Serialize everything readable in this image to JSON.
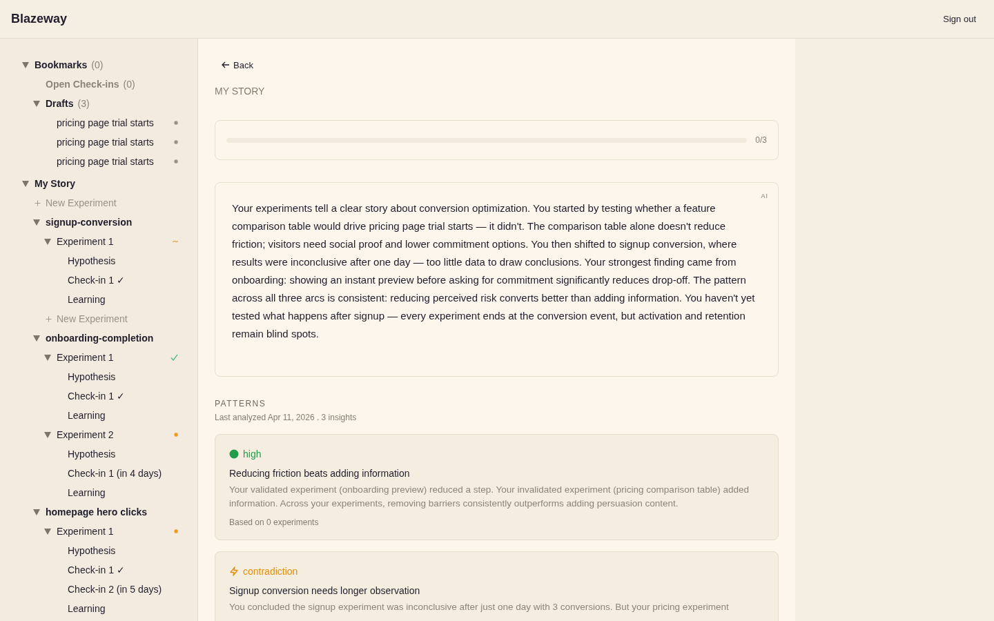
{
  "header": {
    "brand": "Blazeway",
    "sign_out": "Sign out"
  },
  "sidebar": {
    "tree": [
      {
        "label": "Bookmarks",
        "count": "(0)",
        "kind": "section",
        "expanded": true,
        "children": [
          {
            "label": "Open Check-ins",
            "count": "(0)",
            "kind": "empty"
          },
          {
            "label": "Drafts",
            "count": "(3)",
            "kind": "section",
            "expanded": true,
            "children": [
              {
                "label": "pricing page trial starts",
                "kind": "item",
                "marker": {
                  "kind": "dot",
                  "color": "#9a9283"
                }
              },
              {
                "label": "pricing page trial starts",
                "kind": "item",
                "marker": {
                  "kind": "dot",
                  "color": "#9a9283"
                }
              },
              {
                "label": "pricing page trial starts",
                "kind": "item",
                "marker": {
                  "kind": "dot",
                  "color": "#9a9283"
                }
              }
            ]
          }
        ]
      },
      {
        "label": "My Story",
        "kind": "section",
        "expanded": true,
        "children": [
          {
            "label": "New Experiment",
            "kind": "add"
          },
          {
            "label": "signup-conversion",
            "kind": "group",
            "expanded": true,
            "children": [
              {
                "label": "Experiment 1",
                "kind": "item",
                "expanded": true,
                "marker": {
                  "kind": "tilde",
                  "color": "#e0a040"
                },
                "children": [
                  {
                    "label": "Hypothesis",
                    "kind": "item"
                  },
                  {
                    "label": "Check-in 1 ✓",
                    "kind": "item"
                  },
                  {
                    "label": "Learning",
                    "kind": "item"
                  }
                ]
              },
              {
                "label": "New Experiment",
                "kind": "add"
              }
            ]
          },
          {
            "label": "onboarding-completion",
            "kind": "group",
            "expanded": true,
            "children": [
              {
                "label": "Experiment 1",
                "kind": "item",
                "expanded": true,
                "marker": {
                  "kind": "check",
                  "color": "#4fb98a"
                },
                "children": [
                  {
                    "label": "Hypothesis",
                    "kind": "item"
                  },
                  {
                    "label": "Check-in 1 ✓",
                    "kind": "item"
                  },
                  {
                    "label": "Learning",
                    "kind": "item"
                  }
                ]
              },
              {
                "label": "Experiment 2",
                "kind": "item",
                "expanded": true,
                "marker": {
                  "kind": "dot",
                  "color": "#ef9a1a"
                },
                "children": [
                  {
                    "label": "Hypothesis",
                    "kind": "item"
                  },
                  {
                    "label": "Check-in 1 (in 4 days)",
                    "kind": "item"
                  },
                  {
                    "label": "Learning",
                    "kind": "item"
                  }
                ]
              }
            ]
          },
          {
            "label": "homepage hero clicks",
            "kind": "group",
            "expanded": true,
            "children": [
              {
                "label": "Experiment 1",
                "kind": "item",
                "expanded": true,
                "marker": {
                  "kind": "dot",
                  "color": "#ef9a1a"
                },
                "children": [
                  {
                    "label": "Hypothesis",
                    "kind": "item"
                  },
                  {
                    "label": "Check-in 1 ✓",
                    "kind": "item"
                  },
                  {
                    "label": "Check-in 2 (in 5 days)",
                    "kind": "item"
                  },
                  {
                    "label": "Learning",
                    "kind": "item"
                  }
                ]
              }
            ]
          }
        ]
      }
    ]
  },
  "main": {
    "back": "Back",
    "title": "MY STORY",
    "progress": {
      "level": 0,
      "reading": "0/3"
    },
    "story": {
      "badge": "AI",
      "text": "Your experiments tell a clear story about conversion optimization. You started by testing whether a feature comparison table would drive pricing page trial starts — it didn't. The comparison table alone doesn't reduce friction; visitors need social proof and lower commitment options. You then shifted to signup conversion, where results were inconclusive after one day — too little data to draw conclusions. Your strongest finding came from onboarding: showing an instant preview before asking for commitment significantly reduces drop-off. The pattern across all three arcs is consistent: reducing perceived risk converts better than adding information. You haven't yet tested what happens after signup — every experiment ends at the conversion event, but activation and retention remain blind spots."
    },
    "patterns": {
      "heading": "PATTERNS",
      "meta": "Last analyzed Apr 11, 2026 . 3 insights",
      "cards": [
        {
          "kind": "high",
          "tag": "high",
          "title": "Reducing friction beats adding information",
          "body": "Your validated experiment (onboarding preview) reduced a step. Your invalidated experiment (pricing comparison table) added information. Across your experiments, removing barriers consistently outperforms adding persuasion content.",
          "footer": "Based on 0 experiments"
        },
        {
          "kind": "contradiction",
          "tag": "contradiction",
          "title": "Signup conversion needs longer observation",
          "body": "You concluded the signup experiment was inconclusive after just one day with 3 conversions. But your pricing experiment"
        }
      ]
    }
  }
}
